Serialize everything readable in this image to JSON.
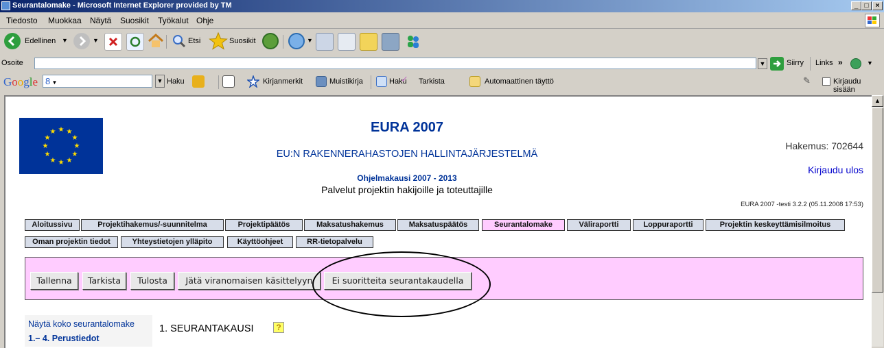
{
  "window": {
    "title": "Seurantalomake - Microsoft Internet Explorer provided by TM",
    "controls": [
      "_",
      "×"
    ],
    "max_label": "□"
  },
  "menu": [
    "Tiedosto",
    "Muokkaa",
    "Näytä",
    "Suosikit",
    "Työkalut",
    "Ohje"
  ],
  "toolbar": {
    "back_label": "Edellinen",
    "search_label": "Etsi",
    "favorites_label": "Suosikit"
  },
  "address": {
    "label": "Osoite",
    "value": "",
    "go_label": "Siirry",
    "links_label": "Links"
  },
  "google_toolbar": {
    "logo": "Google",
    "search_value": "8",
    "haku_label": "Haku",
    "bookmarks_label": "Kirjanmerkit",
    "notebook_label": "Muistikirja",
    "haku2_label": "Haku",
    "check_label": "Tarkista",
    "autofill_label": "Automaattinen täyttö",
    "signin_label": "Kirjaudu sisään"
  },
  "page": {
    "title": "EURA 2007",
    "subtitle": "EU:N RAKENNERAHASTOJEN HALLINTAJÄRJESTELMÄ",
    "period": "Ohjelmakausi 2007 - 2013",
    "tagline": "Palvelut projektin hakijoille ja toteuttajille",
    "application": "Hakemus: 702644",
    "logout": "Kirjaudu ulos",
    "version": "EURA 2007 -testi 3.2.2 (05.11.2008 17:53)"
  },
  "nav_row1": [
    "Aloitussivu",
    "Projektihakemus/-suunnitelma",
    "Projektipäätös",
    "Maksatushakemus",
    "Maksatuspäätös",
    "Seurantalomake",
    "Väliraportti",
    "Loppuraportti",
    "Projektin keskeyttämisilmoitus"
  ],
  "nav_row2": [
    "Oman projektin tiedot",
    "Yhteystietojen ylläpito",
    "Käyttöohjeet",
    "RR-tietopalvelu"
  ],
  "nav_active": "Seurantalomake",
  "actions": [
    "Tallenna",
    "Tarkista",
    "Tulosta",
    "Jätä viranomaisen käsittelyyn",
    "Ei suoritteita seurantakaudella"
  ],
  "sidebar": {
    "show_all": "Näytä koko seurantalomake",
    "first_item": "1.– 4. Perustiedot"
  },
  "section": {
    "heading": "1. SEURANTAKAUSI",
    "help": "?"
  },
  "colors": {
    "nav_bg": "#d7dde9",
    "nav_active_bg": "#ffccff",
    "action_bar_bg": "#ffccff",
    "title_blue": "#003399"
  }
}
